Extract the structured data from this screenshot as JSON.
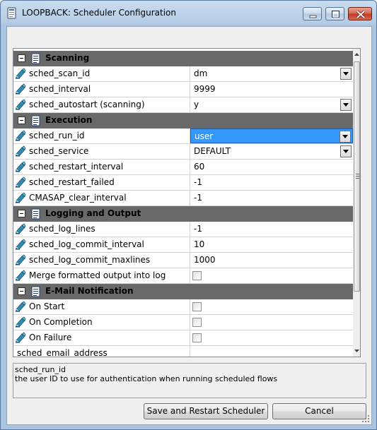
{
  "window": {
    "title": "LOOPBACK: Scheduler Configuration"
  },
  "grid": {
    "sections": [
      {
        "label": "Scanning",
        "rows": [
          {
            "name": "sched_scan_id",
            "value": "dm",
            "type": "combo"
          },
          {
            "name": "sched_interval",
            "value": "9999",
            "type": "text"
          },
          {
            "name": "sched_autostart (scanning)",
            "value": "y",
            "type": "combo"
          }
        ]
      },
      {
        "label": "Execution",
        "rows": [
          {
            "name": "sched_run_id",
            "value": "user",
            "type": "combo",
            "selected": true
          },
          {
            "name": "sched_service",
            "value": "DEFAULT",
            "type": "combo"
          },
          {
            "name": "sched_restart_interval",
            "value": "60",
            "type": "text"
          },
          {
            "name": "sched_restart_failed",
            "value": "-1",
            "type": "text"
          },
          {
            "name": "CMASAP_clear_interval",
            "value": "-1",
            "type": "text"
          }
        ]
      },
      {
        "label": "Logging and Output",
        "rows": [
          {
            "name": "sched_log_lines",
            "value": "-1",
            "type": "text"
          },
          {
            "name": "sched_log_commit_interval",
            "value": "10",
            "type": "text"
          },
          {
            "name": "sched_log_commit_maxlines",
            "value": "1000",
            "type": "text"
          },
          {
            "name": "Merge formatted output into log",
            "value": "",
            "type": "checkbox"
          }
        ]
      },
      {
        "label": "E-Mail Notification",
        "rows": [
          {
            "name": "On Start",
            "value": "",
            "type": "checkbox"
          },
          {
            "name": "On Completion",
            "value": "",
            "type": "checkbox"
          },
          {
            "name": "On Failure",
            "value": "",
            "type": "checkbox"
          },
          {
            "name": "sched_email_address",
            "value": "",
            "type": "text",
            "noicon": true
          }
        ]
      }
    ]
  },
  "description": {
    "title": "sched_run_id",
    "text": "the user ID to use for authentication when running scheduled flows"
  },
  "buttons": {
    "save_label": "Save and Restart Scheduler",
    "cancel_label": "Cancel"
  },
  "colors": {
    "section_bg": "#696969",
    "selection": "#3399ff"
  }
}
